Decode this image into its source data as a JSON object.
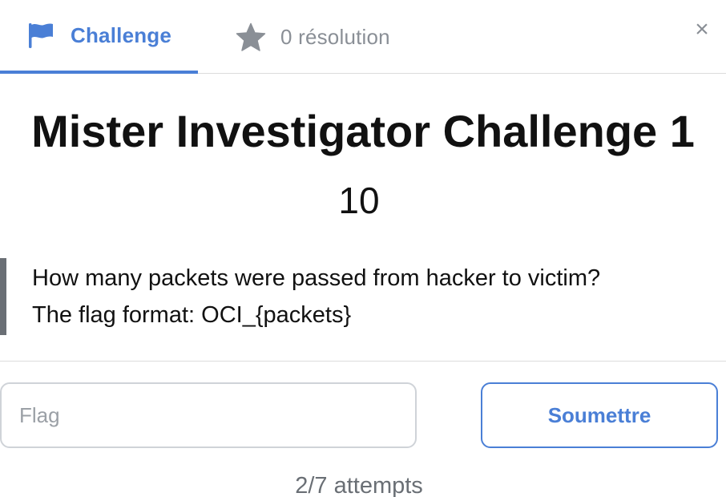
{
  "tabs": {
    "challenge": {
      "label": "Challenge",
      "icon": "flag-icon"
    },
    "solves": {
      "label": "0 résolution",
      "icon": "star-icon"
    }
  },
  "close": {
    "glyph": "×",
    "icon": "close-icon"
  },
  "challenge": {
    "name": "Mister Investigator Challenge 1",
    "value": "10",
    "description": [
      "How many packets were passed from hacker to victim?",
      "The flag format: OCI_{packets}"
    ]
  },
  "form": {
    "flag_placeholder": "Flag",
    "flag_value": "",
    "submit_label": "Soumettre"
  },
  "attempts": "2/7 attempts",
  "colors": {
    "accent": "#4a7fd6",
    "muted": "#8a8f96",
    "text": "#111111",
    "border": "#cfd3d8",
    "quote_bar": "#6a6f75"
  }
}
